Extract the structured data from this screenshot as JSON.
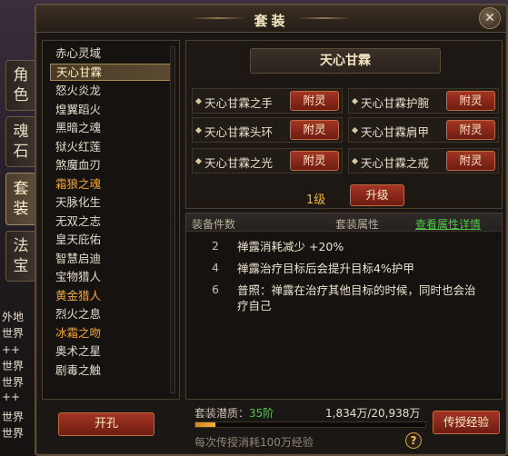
{
  "window": {
    "title": "套装",
    "close_glyph": "✕"
  },
  "side_tabs": [
    {
      "label": "角色",
      "active": false
    },
    {
      "label": "魂石",
      "active": false
    },
    {
      "label": "套装",
      "active": true
    },
    {
      "label": "法宝",
      "active": false
    }
  ],
  "chat_lines": [
    "外地",
    "世界",
    "++",
    "世界",
    "世界",
    "++",
    "世界",
    "世界"
  ],
  "set_list": {
    "items": [
      {
        "label": "赤心灵域",
        "state": "normal"
      },
      {
        "label": "天心甘霖",
        "state": "selected"
      },
      {
        "label": "怒火炎龙",
        "state": "normal"
      },
      {
        "label": "煌翼蹈火",
        "state": "normal"
      },
      {
        "label": "黑暗之魂",
        "state": "normal"
      },
      {
        "label": "狱火红莲",
        "state": "normal"
      },
      {
        "label": "煞魔血刃",
        "state": "normal"
      },
      {
        "label": "霜狼之魂",
        "state": "orange"
      },
      {
        "label": "天脉化生",
        "state": "normal"
      },
      {
        "label": "无双之志",
        "state": "normal"
      },
      {
        "label": "皇天庇佑",
        "state": "normal"
      },
      {
        "label": "智慧启迪",
        "state": "normal"
      },
      {
        "label": "宝物猎人",
        "state": "normal"
      },
      {
        "label": "黄金猎人",
        "state": "orange"
      },
      {
        "label": "烈火之息",
        "state": "normal"
      },
      {
        "label": "冰霜之吻",
        "state": "orange"
      },
      {
        "label": "奥术之星",
        "state": "normal"
      },
      {
        "label": "剧毒之触",
        "state": "normal"
      }
    ]
  },
  "set_detail": {
    "name": "天心甘霖",
    "slots": [
      {
        "name": "天心甘霖之手",
        "button": "附灵"
      },
      {
        "name": "天心甘霖护腕",
        "button": "附灵"
      },
      {
        "name": "天心甘霖头环",
        "button": "附灵"
      },
      {
        "name": "天心甘霖肩甲",
        "button": "附灵"
      },
      {
        "name": "天心甘霖之光",
        "button": "附灵"
      },
      {
        "name": "天心甘霖之戒",
        "button": "附灵"
      }
    ],
    "level": "1级",
    "upgrade_button": "升级"
  },
  "attributes": {
    "header_count": "装备件数",
    "header_attr": "套装属性",
    "header_link": "查看属性详情",
    "rows": [
      {
        "count": "2",
        "desc": "禅露消耗减少 +20%"
      },
      {
        "count": "4",
        "desc": "禅露治疗目标后会提升目标4%护甲"
      },
      {
        "count": "6",
        "desc": "普照：禅露在治疗其他目标的时候，同时也会治疗自己"
      }
    ]
  },
  "bottom": {
    "open_button": "开孔",
    "potential_label": "套装潜质：",
    "potential_value": "35阶",
    "exp_text": "1,834万/20,938万",
    "exp_progress": 0.0876,
    "cost_text": "每次传授消耗100万经验",
    "transfer_button": "传授经验",
    "help_glyph": "?"
  }
}
